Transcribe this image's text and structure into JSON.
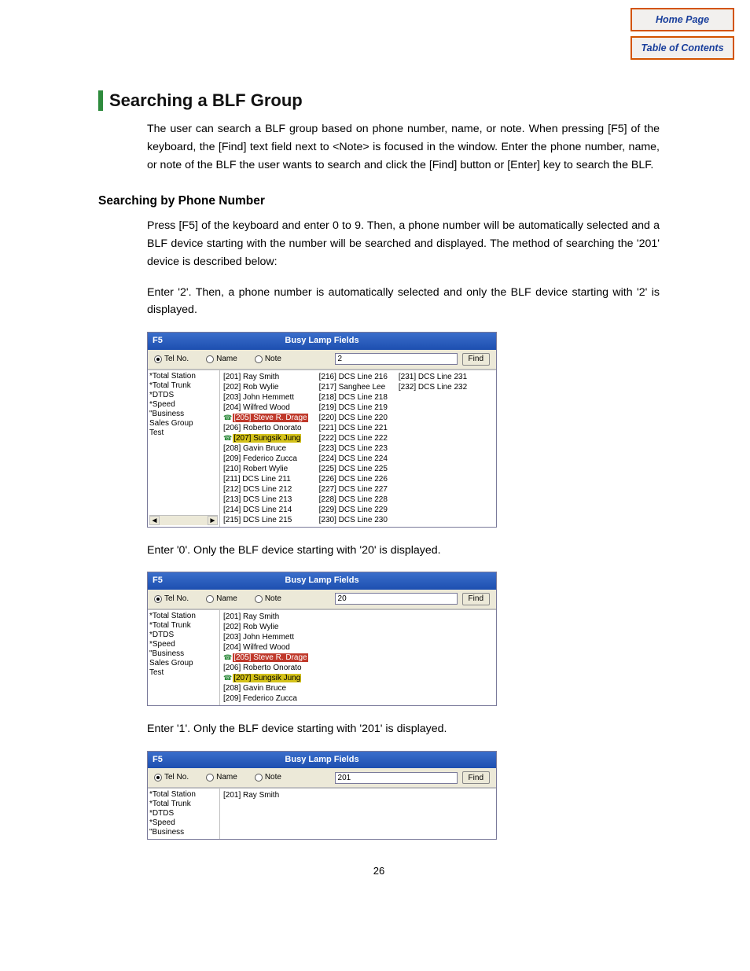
{
  "nav": {
    "home": "Home Page",
    "toc": "Table of Contents"
  },
  "h1": "Searching a BLF Group",
  "intro": "The user can search a BLF group based on phone number, name, or note. When pressing [F5] of the keyboard, the [Find] text field next to <Note> is focused in the window. Enter the phone number, name, or note of the BLF the user wants to search and click the [Find] button or [Enter] key to search the BLF.",
  "h2": "Searching by Phone Number",
  "p1": "Press [F5] of the keyboard and enter 0 to 9. Then, a phone number will be automatically selected and a BLF device starting with the number will be searched and displayed. The method of searching the '201' device is described below:",
  "p2": "Enter '2'. Then, a phone number is automatically selected and only the BLF device starting with '2' is displayed.",
  "p3": "Enter '0'. Only the BLF device starting with '20' is displayed.",
  "p4": "Enter '1'. Only the BLF device starting with '201' is displayed.",
  "win": {
    "f5": "F5",
    "title": "Busy Lamp Fields",
    "telno": "Tel No.",
    "name": "Name",
    "note": "Note",
    "find": "Find",
    "sidebar_full": [
      "*Total Station",
      "*Total Trunk",
      "*DTDS",
      "*Speed",
      "\"Business",
      "Sales Group",
      "Test"
    ],
    "sidebar_short": [
      "*Total Station",
      "*Total Trunk",
      "*DTDS",
      "*Speed",
      "\"Business"
    ]
  },
  "s1": {
    "search": "2",
    "col1": [
      "[201] Ray Smith",
      "[202] Rob Wylie",
      "[203] John Hemmett",
      "[204] Wilfred Wood",
      "[205] Steve R. Drage",
      "[206] Roberto Onorato",
      "[207] Sungsik Jung",
      "[208] Gavin Bruce",
      "[209] Federico Zucca",
      "[210] Robert Wylie",
      "[211] DCS Line 211",
      "[212] DCS Line 212",
      "[213] DCS Line 213",
      "[214] DCS Line 214",
      "[215] DCS Line 215"
    ],
    "col2": [
      "[216] DCS Line 216",
      "[217] Sanghee Lee",
      "[218] DCS Line 218",
      "[219] DCS Line 219",
      "[220] DCS Line 220",
      "[221] DCS Line 221",
      "[222] DCS Line 222",
      "[223] DCS Line 223",
      "[224] DCS Line 224",
      "[225] DCS Line 225",
      "[226] DCS Line 226",
      "[227] DCS Line 227",
      "[228] DCS Line 228",
      "[229] DCS Line 229",
      "[230] DCS Line 230"
    ],
    "col3": [
      "[231] DCS Line 231",
      "[232] DCS Line 232"
    ]
  },
  "s2": {
    "search": "20",
    "col1": [
      "[201] Ray Smith",
      "[202] Rob Wylie",
      "[203] John Hemmett",
      "[204] Wilfred Wood",
      "[205] Steve R. Drage",
      "[206] Roberto Onorato",
      "[207] Sungsik Jung",
      "[208] Gavin Bruce",
      "[209] Federico Zucca"
    ]
  },
  "s3": {
    "search": "201",
    "col1": [
      "[201] Ray Smith"
    ]
  },
  "pagenum": "26"
}
